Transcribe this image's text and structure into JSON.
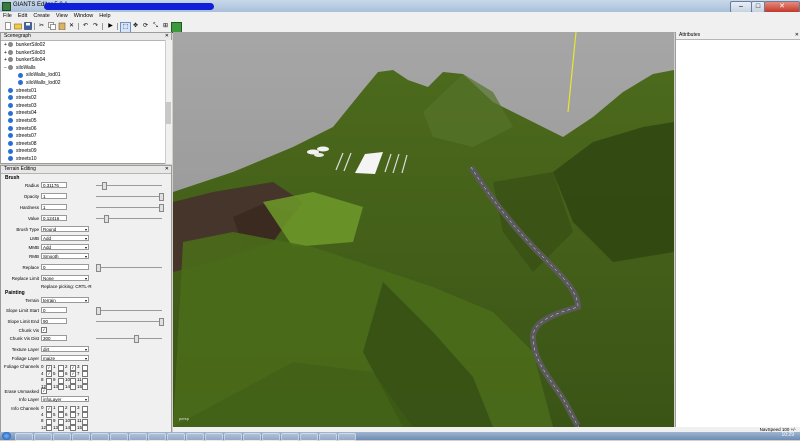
{
  "window": {
    "title": "GIANTS Editor 5.0.1",
    "controls": [
      "–",
      "□",
      "✕"
    ]
  },
  "menu": [
    "File",
    "Edit",
    "Create",
    "View",
    "Window",
    "Help"
  ],
  "scenegraph": {
    "title": "Scenegraph",
    "items": [
      {
        "label": "bunkerSilo02",
        "indent": 1,
        "color": "#888888",
        "expand": "+"
      },
      {
        "label": "bunkerSilo03",
        "indent": 1,
        "color": "#888888",
        "expand": "+"
      },
      {
        "label": "bunkerSilo04",
        "indent": 1,
        "color": "#888888",
        "expand": "+"
      },
      {
        "label": "siloWalls",
        "indent": 1,
        "color": "#888888",
        "expand": "−"
      },
      {
        "label": "siloWalls_lod01",
        "indent": 2,
        "color": "#2a6fd6",
        "expand": ""
      },
      {
        "label": "siloWalls_lod02",
        "indent": 2,
        "color": "#2a6fd6",
        "expand": ""
      },
      {
        "label": "streets01",
        "indent": 1,
        "color": "#2a6fd6",
        "expand": ""
      },
      {
        "label": "streets02",
        "indent": 1,
        "color": "#2a6fd6",
        "expand": ""
      },
      {
        "label": "streets03",
        "indent": 1,
        "color": "#2a6fd6",
        "expand": ""
      },
      {
        "label": "streets04",
        "indent": 1,
        "color": "#2a6fd6",
        "expand": ""
      },
      {
        "label": "streets05",
        "indent": 1,
        "color": "#2a6fd6",
        "expand": ""
      },
      {
        "label": "streets06",
        "indent": 1,
        "color": "#2a6fd6",
        "expand": ""
      },
      {
        "label": "streets07",
        "indent": 1,
        "color": "#2a6fd6",
        "expand": ""
      },
      {
        "label": "streets08",
        "indent": 1,
        "color": "#2a6fd6",
        "expand": ""
      },
      {
        "label": "streets09",
        "indent": 1,
        "color": "#2a6fd6",
        "expand": ""
      },
      {
        "label": "streets10",
        "indent": 1,
        "color": "#2a6fd6",
        "expand": ""
      }
    ]
  },
  "terrain": {
    "title": "Terrain Editing",
    "brush_section": "Brush",
    "radius": {
      "label": "Radius",
      "value": "0.31176",
      "slider": 0.1
    },
    "opacity": {
      "label": "Opacity",
      "value": "1",
      "slider": 1.0
    },
    "hardness": {
      "label": "Hardness",
      "value": "1",
      "slider": 1.0
    },
    "valuefield": {
      "label": "Value",
      "value": "0.12416",
      "slider": 0.12
    },
    "brush_type": {
      "label": "Brush Type",
      "value": "Round"
    },
    "lmb": {
      "label": "LMB",
      "value": "Add"
    },
    "mmb": {
      "label": "MMB",
      "value": "Add"
    },
    "rmb": {
      "label": "RMB",
      "value": "Smooth"
    },
    "replace": {
      "label": "Replace",
      "value": "0",
      "slider": 0.0
    },
    "replace_limit": {
      "label": "Replace Limit",
      "value": "None"
    },
    "replace_hint": "Replace picking: CRTL-R",
    "painting_section": "Painting",
    "terrain_field": {
      "label": "Terrain",
      "value": "terrain"
    },
    "slope_start": {
      "label": "Slope Limit Start",
      "value": "0",
      "slider": 0.0
    },
    "slope_end": {
      "label": "Slope Limit End",
      "value": "90",
      "slider": 1.0
    },
    "chunk_vis": {
      "label": "Chunk Vis",
      "checked": "✓"
    },
    "chunk_vis_dist": {
      "label": "Chunk Vis Dist",
      "value": "300",
      "slider": 0.6
    },
    "texture_layer": {
      "label": "Texture Layer",
      "value": "dirt"
    },
    "foliage_layer": {
      "label": "Foliage Layer",
      "value": "maize"
    },
    "foliage_channels": {
      "label": "Foliage Channels",
      "numbers": [
        "0",
        "1",
        "2",
        "3",
        "4",
        "5",
        "6",
        "7",
        "8",
        "9",
        "10",
        "11",
        "12",
        "13",
        "14",
        "15"
      ],
      "checks": [
        "✓",
        "",
        "✓",
        "",
        "✓",
        "",
        "✓",
        "",
        "",
        "",
        "",
        "",
        "",
        "",
        "",
        ""
      ]
    },
    "erase_unmasked": {
      "label": "Erase Unmasked",
      "checked": "✓"
    },
    "info_layer": {
      "label": "Info Layer",
      "value": "infoLayer"
    },
    "info_channels": {
      "label": "Info Channels",
      "numbers": [
        "0",
        "1",
        "2",
        "3",
        "4",
        "5",
        "6",
        "7",
        "8",
        "9",
        "10",
        "11",
        "12",
        "13",
        "14",
        "15"
      ],
      "checks": [
        "✓",
        "",
        "",
        "",
        "",
        "",
        "",
        "",
        "",
        "",
        "",
        "",
        "",
        "",
        "",
        ""
      ]
    }
  },
  "viewport": {
    "label": "persp"
  },
  "attributes": {
    "title": "Attributes"
  },
  "status": {
    "text": "NavSpeed 100 +/-"
  },
  "taskbar": {
    "clock": "10:29"
  },
  "icons": [
    "new-icon",
    "open-icon",
    "save-icon",
    "undo-icon",
    "redo-icon",
    "play-icon",
    "select-icon",
    "move-icon",
    "rotate-icon",
    "scale-icon",
    "terrain-icon"
  ]
}
